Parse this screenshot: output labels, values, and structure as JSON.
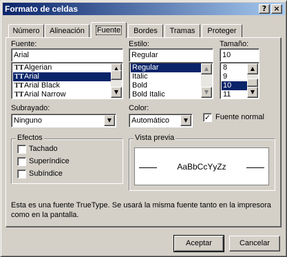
{
  "window": {
    "title": "Formato de celdas",
    "help_glyph": "?",
    "close_glyph": "×"
  },
  "tabs": [
    {
      "label": "Número"
    },
    {
      "label": "Alineación"
    },
    {
      "label": "Fuente"
    },
    {
      "label": "Bordes"
    },
    {
      "label": "Tramas"
    },
    {
      "label": "Proteger"
    }
  ],
  "active_tab": "Fuente",
  "font": {
    "label": "Fuente:",
    "value": "Arial",
    "items": [
      {
        "label": "Algerian"
      },
      {
        "label": "Arial"
      },
      {
        "label": "Arial Black"
      },
      {
        "label": "Arial Narrow"
      }
    ],
    "selected": "Arial",
    "icon": "truetype-icon"
  },
  "style": {
    "label": "Estilo:",
    "value": "Regular",
    "items": [
      {
        "label": "Regular"
      },
      {
        "label": "Italic"
      },
      {
        "label": "Bold"
      },
      {
        "label": "Bold Italic"
      }
    ],
    "selected": "Regular"
  },
  "size": {
    "label": "Tamaño:",
    "value": "10",
    "items": [
      {
        "label": "8"
      },
      {
        "label": "9"
      },
      {
        "label": "10"
      },
      {
        "label": "11"
      }
    ],
    "selected": "10"
  },
  "underline": {
    "label": "Subrayado:",
    "value": "Ninguno"
  },
  "color": {
    "label": "Color:",
    "value": "Automático"
  },
  "normal_font": {
    "label": "Fuente normal",
    "checked": true
  },
  "effects": {
    "title": "Efectos",
    "items": [
      {
        "label": "Tachado",
        "checked": false
      },
      {
        "label": "Superíndice",
        "checked": false
      },
      {
        "label": "Subíndice",
        "checked": false
      }
    ]
  },
  "preview": {
    "title": "Vista previa",
    "sample": "AaBbCcYyZz"
  },
  "description": "Esta es una fuente TrueType. Se usará la misma fuente tanto en la impresora como en la pantalla.",
  "buttons": {
    "ok": "Aceptar",
    "cancel": "Cancelar"
  },
  "colors": {
    "title_gradient_start": "#0a246a",
    "title_gradient_end": "#a6caf0",
    "selection": "#0a246a",
    "face": "#d4d0c8"
  }
}
